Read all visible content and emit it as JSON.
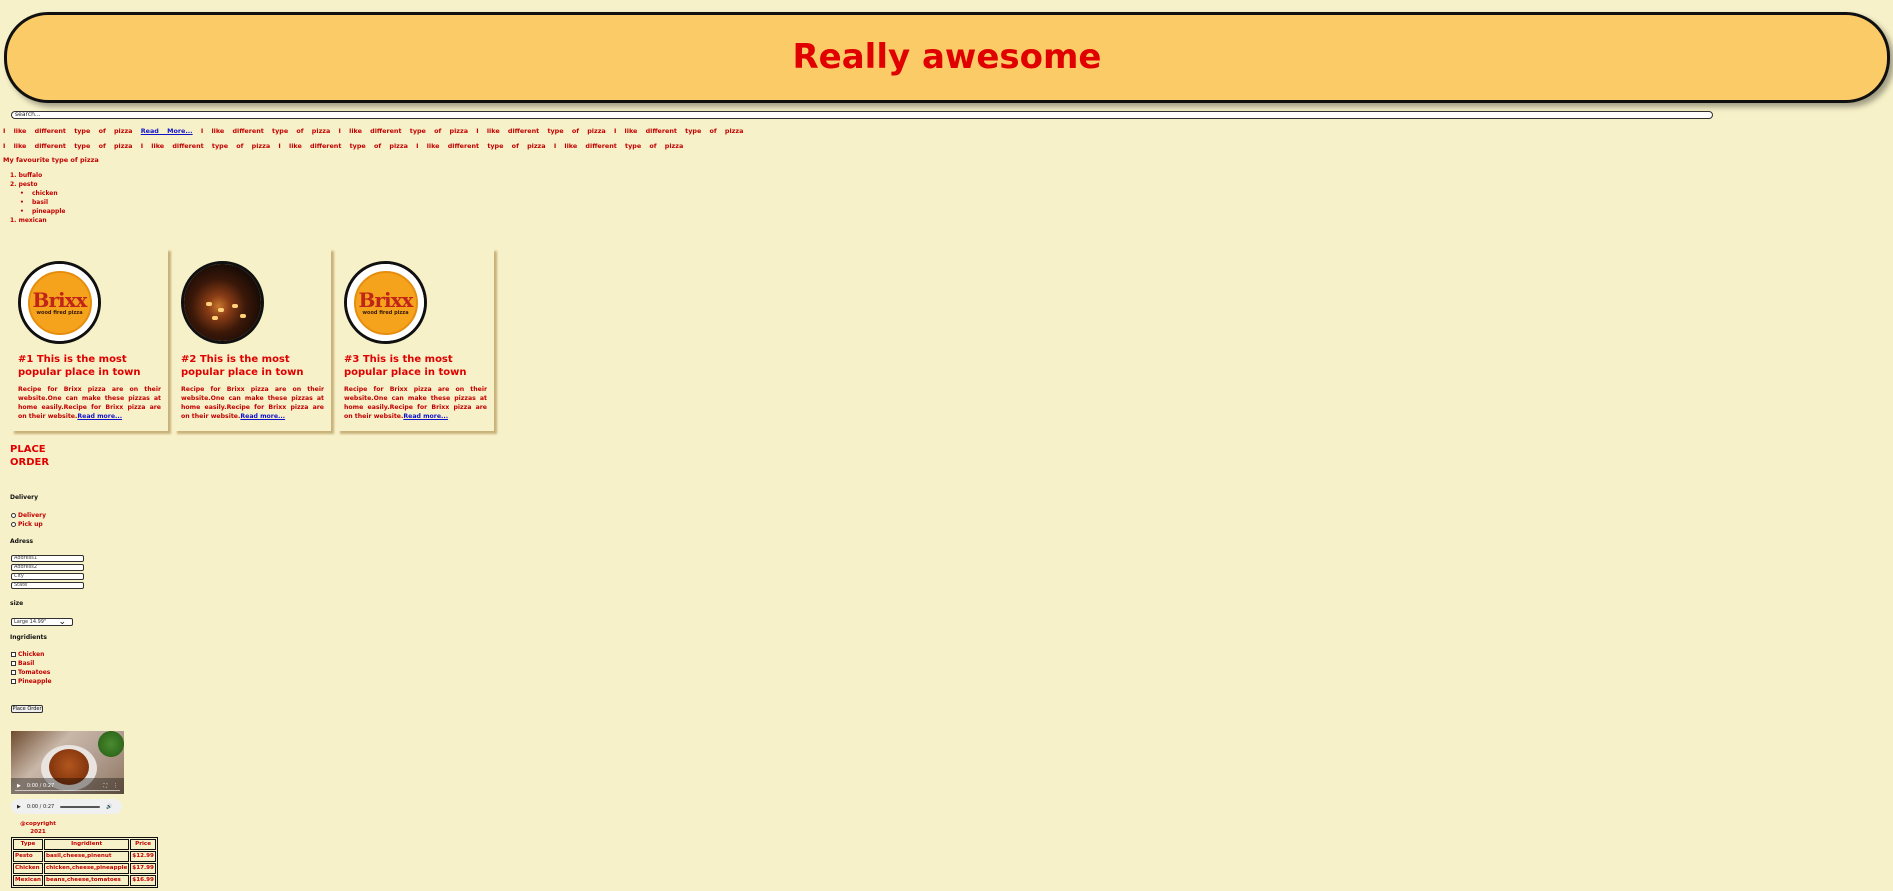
{
  "header": {
    "title": "Really awesome"
  },
  "search": {
    "placeholder": "search..."
  },
  "marquee": {
    "line1_a": "I like different type of pizza",
    "line1_link": "Read More...",
    "line1_b": "I like different type of pizza I like different type of pizza I like different type of pizza I like different type of pizza",
    "line2": "I like different type of pizza I like different type of pizza I like different type of pizza I like different type of pizza I like different type of pizza"
  },
  "favourite": {
    "title": "My favourite type of pizza",
    "items": [
      {
        "marker": "1.",
        "label": "buffalo"
      },
      {
        "marker": "2.",
        "label": "pesto"
      },
      {
        "marker": "1.",
        "label": "mexican"
      }
    ],
    "sub_items": [
      "chicken",
      "basil",
      "pineapple"
    ]
  },
  "cards": [
    {
      "title": "#1 This is the most popular place in town",
      "text": "Recipe for Brixx pizza are on their website.One can make these pizzas at home easily.Recipe for Brixx pizza are on their website.",
      "link": "Read more...",
      "image": "brixx-logo",
      "logo_text": "Brixx",
      "logo_sub": "wood fired pizza"
    },
    {
      "title": "#2 This is the most popular place in town",
      "text": "Recipe for Brixx pizza are on their website.One can make these pizzas at home easily.Recipe for Brixx pizza are on their website.",
      "link": "Read more...",
      "image": "restaurant-photo"
    },
    {
      "title": "#3 This is the most popular place in town",
      "text": "Recipe for Brixx pizza are on their website.One can make these pizzas at home easily.Recipe for Brixx pizza are on their website.",
      "link": "Read more...",
      "image": "brixx-logo",
      "logo_text": "Brixx",
      "logo_sub": "wood fired pizza"
    }
  ],
  "order": {
    "title": "PLACE ORDER",
    "delivery_label": "Delivery",
    "delivery_options": [
      "Delivery",
      "Pick up"
    ],
    "address_label": "Adress",
    "address_fields": [
      {
        "placeholder": "Address1"
      },
      {
        "placeholder": "Address2"
      },
      {
        "placeholder": "City"
      },
      {
        "placeholder": "State"
      }
    ],
    "size_label": "size",
    "size_value": "Large 14.99\"",
    "ingredients_label": "Ingridients",
    "ingredients": [
      "Chicken",
      "Basil",
      "Tomatoes",
      "Pineapple"
    ],
    "button": "Place Order"
  },
  "video": {
    "time": "0:00 / 0:27"
  },
  "audio": {
    "time": "0:00 / 0:27"
  },
  "copyright": "@copyright 2021",
  "table": {
    "headers": [
      "Type",
      "Ingridient",
      "Price"
    ],
    "rows": [
      [
        "Pesto",
        "basil,cheese,pinenut",
        "$12.99"
      ],
      [
        "Chicken",
        "chicken,cheese,pineapple",
        "$17.99"
      ],
      [
        "Mexican",
        "beans,cheese,tomatoes",
        "$16.99"
      ]
    ]
  },
  "colors": {
    "background": "#f7f1c9",
    "header_bg": "#fbcb68",
    "accent_red": "#e00000",
    "text_red": "#c10000",
    "link_blue": "#1111cc"
  }
}
